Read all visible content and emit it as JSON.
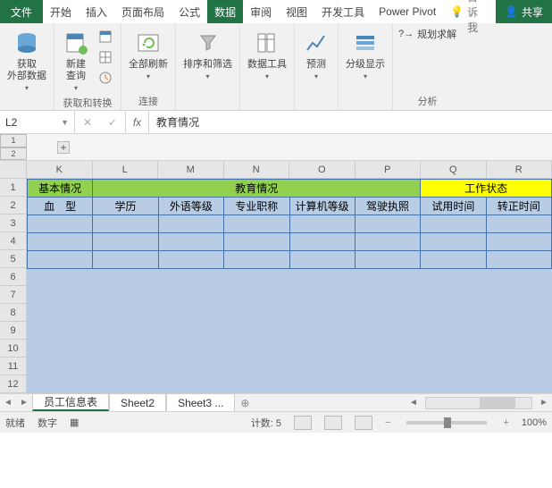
{
  "titlebar": {
    "file": "文件",
    "tabs": [
      "开始",
      "插入",
      "页面布局",
      "公式",
      "数据",
      "审阅",
      "视图",
      "开发工具",
      "Power Pivot"
    ],
    "active_index": 4,
    "tell_me": "告诉我",
    "share": "共享"
  },
  "ribbon": {
    "g1": {
      "btn": "获取\n外部数据",
      "name": ""
    },
    "g2": {
      "btn": "新建\n查询",
      "name": "获取和转换"
    },
    "g3": {
      "btn": "全部刷新",
      "name": "连接"
    },
    "g4": {
      "btn": "排序和筛选"
    },
    "g5": {
      "btn": "数据工具"
    },
    "g6": {
      "btn": "预测"
    },
    "g7": {
      "btn": "分级显示"
    },
    "g8": {
      "btn": "规划求解",
      "name": "分析"
    }
  },
  "formula": {
    "namebox": "L2",
    "value": "教育情况"
  },
  "grid": {
    "cols": [
      "K",
      "L",
      "M",
      "N",
      "O",
      "P",
      "Q",
      "R"
    ],
    "rows": [
      "1",
      "2",
      "3",
      "4",
      "5",
      "6",
      "7",
      "8",
      "9",
      "10",
      "11",
      "12"
    ],
    "row1": {
      "basic": "基本情况",
      "edu": "教育情况",
      "work": "工作状态"
    },
    "row2": [
      "血　型",
      "学历",
      "外语等级",
      "专业职称",
      "计算机等级",
      "驾驶执照",
      "试用时间",
      "转正时间"
    ]
  },
  "sheets": {
    "tabs": [
      "员工信息表",
      "Sheet2",
      "Sheet3 ..."
    ],
    "active": 0
  },
  "status": {
    "ready": "就绪",
    "mode": "数字",
    "count_label": "计数:",
    "count": "5",
    "zoom": "100%"
  }
}
